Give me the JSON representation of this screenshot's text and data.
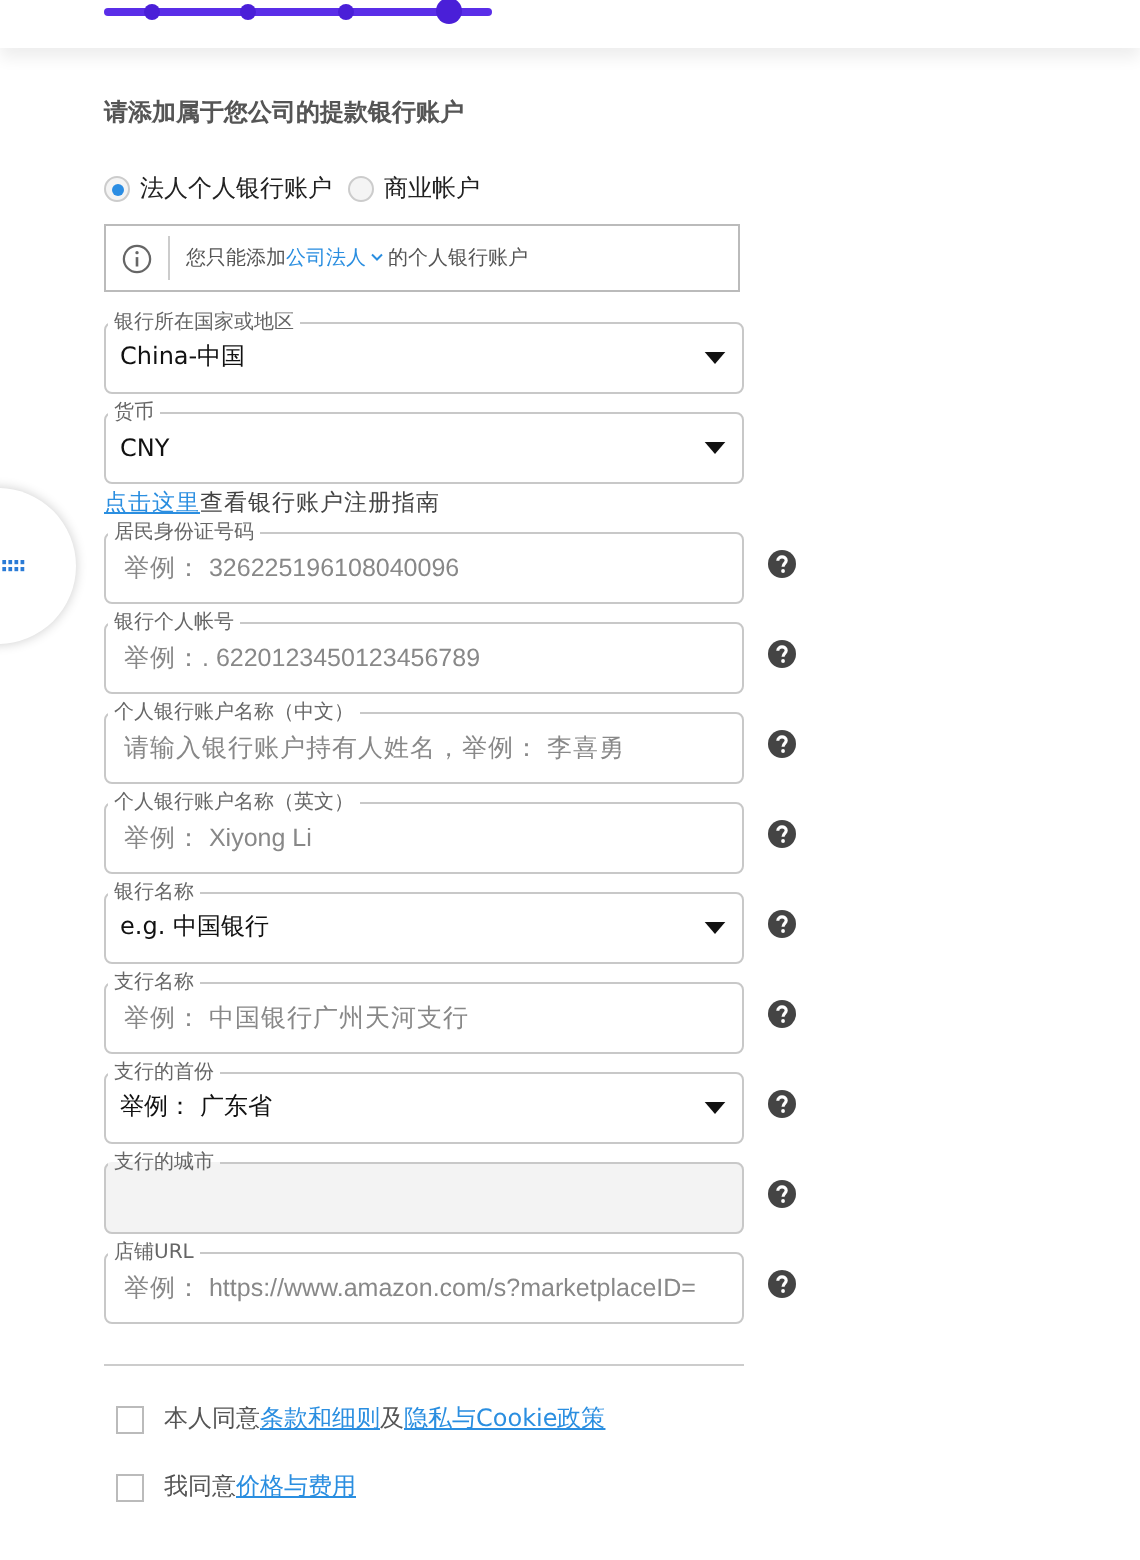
{
  "stepper": {
    "steps": [
      {
        "selected": false
      },
      {
        "selected": false
      },
      {
        "selected": false
      },
      {
        "selected": true
      }
    ]
  },
  "heading": "请添加属于您公司的提款银行账户",
  "account_types": [
    {
      "label": "法人个人银行账户",
      "selected": true
    },
    {
      "label": "商业帐户",
      "selected": false
    }
  ],
  "notice": {
    "before": "您只能添加",
    "link": "公司法人",
    "after": "的个人银行账户"
  },
  "bank_fields": [
    {
      "kind": "select",
      "label": "银行所在国家或地区",
      "value": "China-中国",
      "help": false
    },
    {
      "kind": "select",
      "label": "货币",
      "value": "CNY",
      "help": false
    }
  ],
  "guide": {
    "link": "点击这里",
    "text": "查看银行账户注册指南"
  },
  "account_fields": [
    {
      "kind": "text",
      "label": "居民身份证号码",
      "placeholder": "举例： 326225196108040096",
      "help": true
    },
    {
      "kind": "text",
      "label": "银行个人帐号",
      "placeholder": "举例：. 6220123450123456789",
      "help": true
    },
    {
      "kind": "text",
      "label": "个人银行账户名称（中文）",
      "placeholder": "请输入银行账户持有人姓名，举例： 李喜勇",
      "help": true
    },
    {
      "kind": "text",
      "label": "个人银行账户名称（英文）",
      "placeholder": "举例： Xiyong Li",
      "help": true
    },
    {
      "kind": "select",
      "label": "银行名称",
      "value": "e.g. 中国银行",
      "help": true
    },
    {
      "kind": "text",
      "label": "支行名称",
      "placeholder": "举例： 中国银行广州天河支行",
      "help": true
    },
    {
      "kind": "select",
      "label": "支行的首份",
      "value": "举例： 广东省",
      "help": true
    },
    {
      "kind": "disabled",
      "label": "支行的城市",
      "help": true
    },
    {
      "kind": "text",
      "label": "店铺URL",
      "placeholder": "举例： https://www.amazon.com/s?marketplaceID=",
      "help": true
    }
  ],
  "agreements": [
    {
      "checked": false,
      "parts": [
        {
          "text": "本人同意",
          "link": false
        },
        {
          "text": "条款和细则",
          "link": true
        },
        {
          "text": "及",
          "link": false
        },
        {
          "text": "隐私与Cookie政策",
          "link": true
        }
      ]
    },
    {
      "checked": false,
      "parts": [
        {
          "text": "我同意",
          "link": false
        },
        {
          "text": "价格与费用",
          "link": true
        }
      ]
    }
  ]
}
